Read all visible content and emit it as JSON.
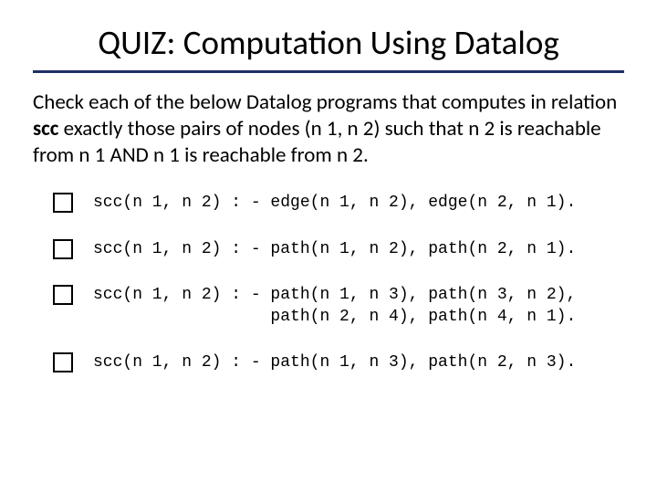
{
  "title": "QUIZ: Computation Using Datalog",
  "prompt_pre": "Check each of the below Datalog programs that computes in relation ",
  "prompt_kw": "scc",
  "prompt_post": " exactly those pairs of nodes (n 1, n 2) such that n 2 is reachable from n 1 AND n 1 is reachable from n 2.",
  "options": [
    "scc(n 1, n 2) : - edge(n 1, n 2), edge(n 2, n 1).",
    "scc(n 1, n 2) : - path(n 1, n 2), path(n 2, n 1).",
    "scc(n 1, n 2) : - path(n 1, n 3), path(n 3, n 2),\n                  path(n 2, n 4), path(n 4, n 1).",
    "scc(n 1, n 2) : - path(n 1, n 3), path(n 2, n 3)."
  ]
}
